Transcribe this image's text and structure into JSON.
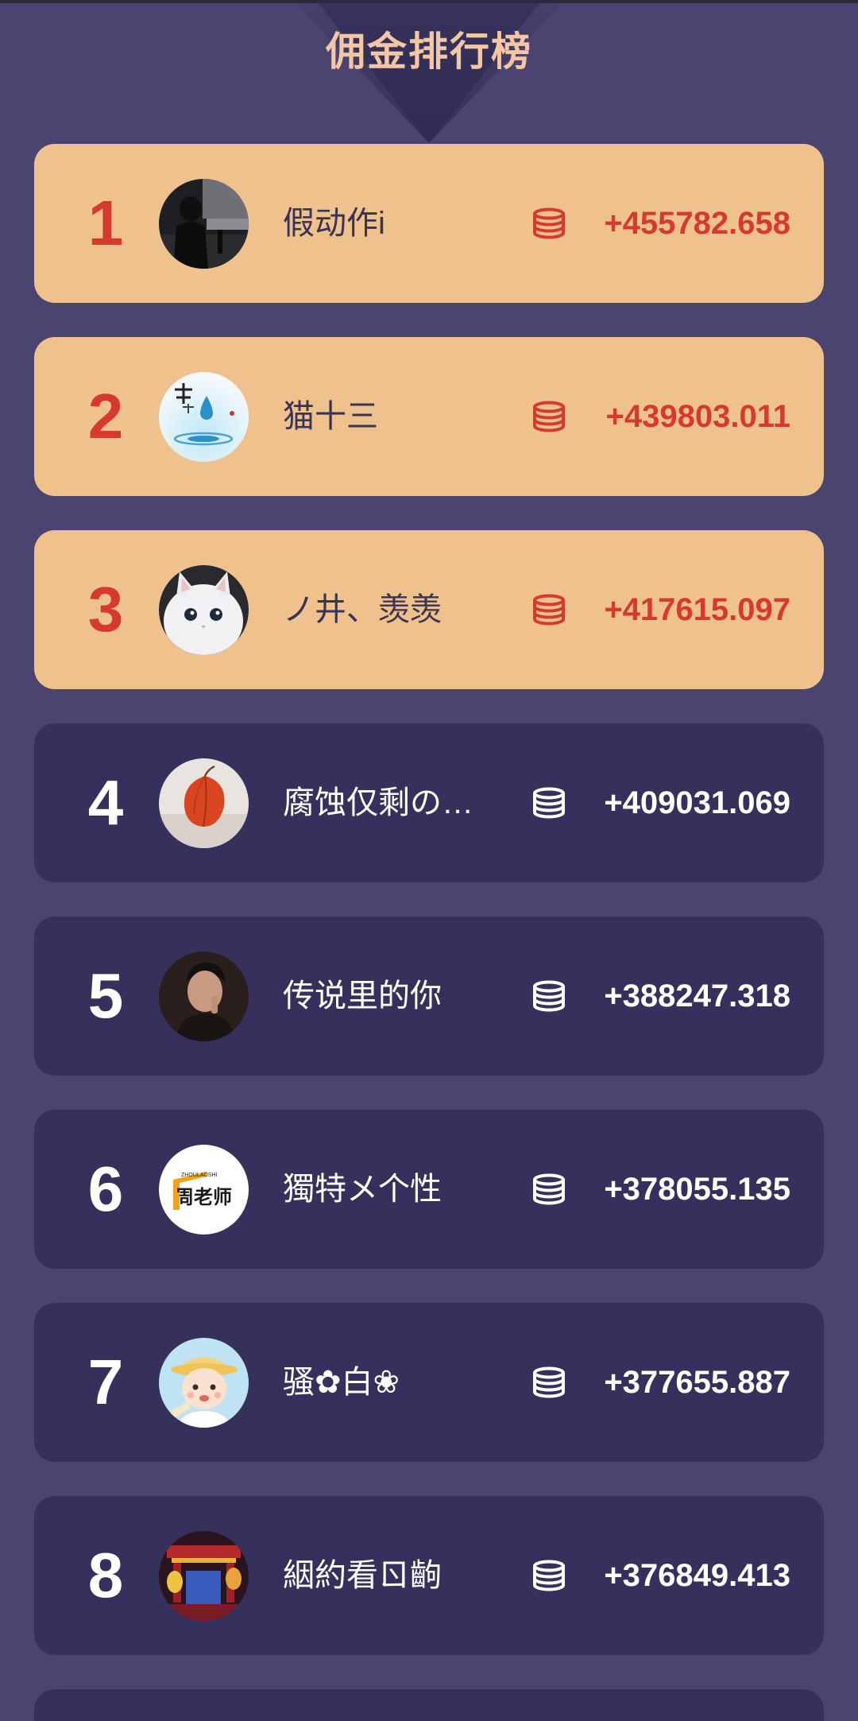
{
  "page": {
    "title": "佣金排行榜",
    "colors": {
      "background": "#4b4470",
      "top3_card": "#efc18d",
      "card": "#35315c",
      "accent_red": "#d63a2f",
      "title": "#f3c7a4"
    }
  },
  "ranking": [
    {
      "rank": "1",
      "name": "假动作i",
      "amount": "+455782.658",
      "avatar": "person-dark-photo"
    },
    {
      "rank": "2",
      "name": "猫十三",
      "amount": "+439803.011",
      "avatar": "water-drop-calligraphy"
    },
    {
      "rank": "3",
      "name": "ノ井、羡羡",
      "amount": "+417615.097",
      "avatar": "white-cat"
    },
    {
      "rank": "4",
      "name": "腐蚀仅剩の…",
      "amount": "+409031.069",
      "avatar": "physalis-lantern"
    },
    {
      "rank": "5",
      "name": "传说里的你",
      "amount": "+388247.318",
      "avatar": "man-portrait"
    },
    {
      "rank": "6",
      "name": "獨特メ个性",
      "amount": "+378055.135",
      "avatar": "zhou-teacher-logo"
    },
    {
      "rank": "7",
      "name": "骚✿白❀",
      "amount": "+377655.887",
      "avatar": "cartoon-boy"
    },
    {
      "rank": "8",
      "name": "絪約看ㄖ齣",
      "amount": "+376849.413",
      "avatar": "chinese-gate-night"
    }
  ],
  "icons": {
    "coin": "coin-stack-icon"
  },
  "avatar_texts": {
    "zhou_logo": "周老师",
    "zhou_small": "ZHOULAOSHI"
  }
}
